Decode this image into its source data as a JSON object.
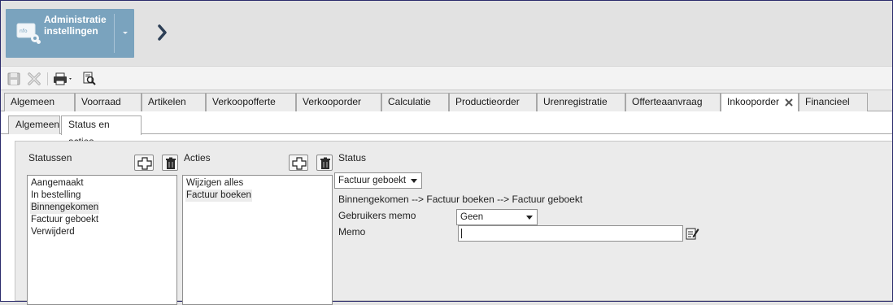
{
  "header": {
    "module_title": "Administratie instellingen"
  },
  "toolbar": {
    "icons": [
      "save-icon",
      "discard-icon",
      "print-icon",
      "print-preview-icon"
    ]
  },
  "tabs": [
    {
      "label": "Algemeen"
    },
    {
      "label": "Voorraad"
    },
    {
      "label": "Artikelen"
    },
    {
      "label": "Verkoopofferte"
    },
    {
      "label": "Verkooporder"
    },
    {
      "label": "Calculatie"
    },
    {
      "label": "Productieorder"
    },
    {
      "label": "Urenregistratie"
    },
    {
      "label": "Offerteaanvraag"
    },
    {
      "label": "Inkooporder",
      "active": true
    },
    {
      "label": "Financieel"
    }
  ],
  "subtabs": [
    {
      "label": "Algemeen"
    },
    {
      "label": "Status en acties",
      "active": true
    }
  ],
  "statuses": {
    "title": "Statussen",
    "items": [
      "Aangemaakt",
      "In bestelling",
      "Binnengekomen",
      "Factuur geboekt",
      "Verwijderd"
    ],
    "selected": "Binnengekomen"
  },
  "actions": {
    "title": "Acties",
    "items": [
      "Wijzigen alles",
      "Factuur boeken"
    ],
    "selected": "Factuur boeken"
  },
  "status_detail": {
    "title": "Status",
    "selected_status": "Factuur geboekt",
    "flow_text": "Binnengekomen --> Factuur boeken --> Factuur geboekt",
    "user_memo_label": "Gebruikers memo",
    "user_memo_value": "Geen",
    "memo_label": "Memo",
    "memo_value": ""
  },
  "colors": {
    "header_tile": "#7aa3be",
    "panel_bg": "#ebebeb"
  }
}
